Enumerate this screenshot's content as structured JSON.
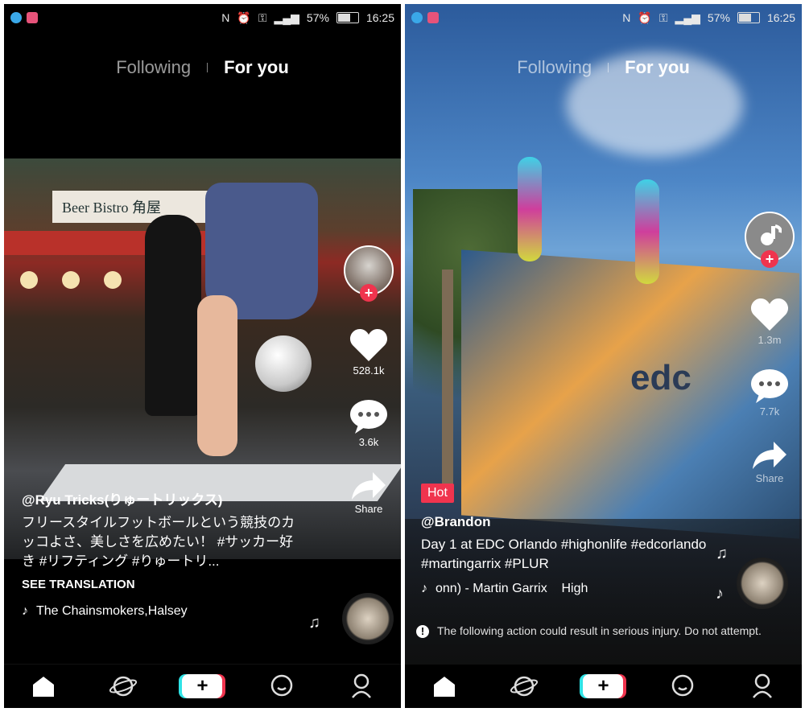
{
  "status_bar": {
    "battery": "57%",
    "time": "16:25"
  },
  "tabs": {
    "following": "Following",
    "for_you": "For you"
  },
  "left": {
    "storefront_sign": "Beer Bistro 角屋",
    "likes": "528.1k",
    "comments": "3.6k",
    "share": "Share",
    "username": "@Ryu Tricks(りゅートリックス)",
    "caption": "フリースタイルフットボールという競技のカッコよさ、美しさを広めたい！ #サッカー好き #リフティング #りゅートリ...",
    "see_translation": "SEE TRANSLATION",
    "music": "The Chainsmokers,Halsey"
  },
  "right": {
    "likes": "1.3m",
    "comments": "7.7k",
    "share": "Share",
    "hot": "Hot",
    "username": "@Brandon",
    "caption": "Day 1 at EDC Orlando #highonlife #edcorlando #martingarrix #PLUR",
    "music": "onn) - Martin Garrix    High",
    "warning": "The following action could result in serious injury. Do not attempt."
  },
  "nav": {
    "icons": [
      "home-icon",
      "discover-icon",
      "create-icon",
      "inbox-icon",
      "profile-icon"
    ],
    "create_glyph": "+"
  },
  "colors": {
    "accent_red": "#f0344e",
    "accent_cyan": "#2fe3e6"
  }
}
